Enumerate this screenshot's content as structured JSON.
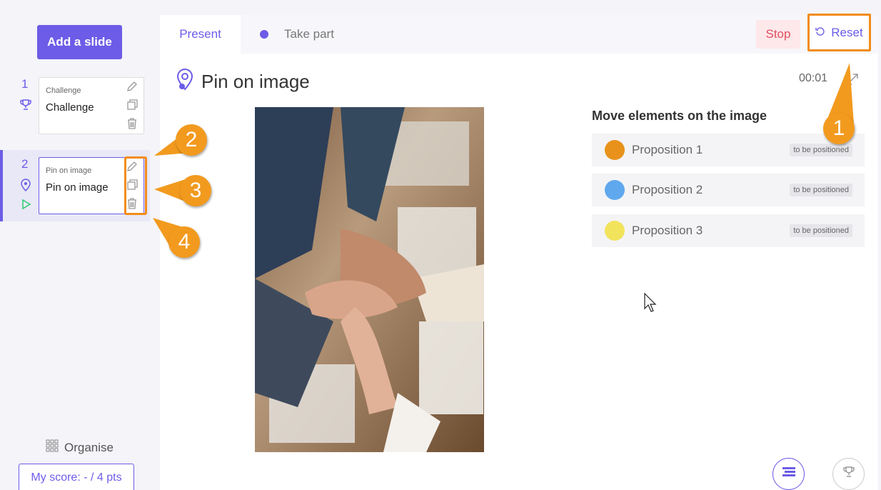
{
  "sidebar": {
    "add_slide_label": "Add a slide",
    "slides": [
      {
        "number": "1",
        "type_label": "Challenge",
        "title": "Challenge",
        "icon": "trophy-icon"
      },
      {
        "number": "2",
        "type_label": "Pin on image",
        "title": "Pin on image",
        "icon": "map-pin-icon",
        "active": true
      }
    ],
    "organise_label": "Organise",
    "score_label": "My score: - / 4 pts"
  },
  "tabs": {
    "present": "Present",
    "take_part": "Take part"
  },
  "actions": {
    "stop": "Stop",
    "reset": "Reset"
  },
  "slide": {
    "title": "Pin on image",
    "timer": "00:01"
  },
  "panel": {
    "title": "Move elements on the image",
    "propositions": [
      {
        "label": "Proposition 1",
        "status": "to be positioned",
        "color": "#e8921c"
      },
      {
        "label": "Proposition 2",
        "status": "to be positioned",
        "color": "#5fa8ee"
      },
      {
        "label": "Proposition 3",
        "status": "to be positioned",
        "color": "#f2e35c"
      }
    ]
  },
  "callouts": [
    "1",
    "2",
    "3",
    "4"
  ],
  "colors": {
    "accent": "#6c5ce7",
    "callout": "#f29a1e",
    "stop": "#e04d5e"
  }
}
